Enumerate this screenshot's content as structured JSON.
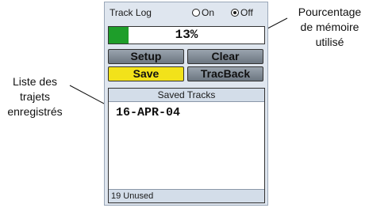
{
  "track_log": {
    "title": "Track Log",
    "on_label": "On",
    "off_label": "Off",
    "selected": "Off",
    "memory_percent_label": "13%",
    "memory_fraction": 0.13
  },
  "buttons": {
    "setup": "Setup",
    "clear": "Clear",
    "save": "Save",
    "tracback": "TracBack"
  },
  "saved_tracks": {
    "header": "Saved Tracks",
    "items": [
      "16-APR-04"
    ],
    "footer": "19 Unused"
  },
  "annotations": {
    "memory": [
      "Pourcentage",
      "de mémoire",
      "utilisé"
    ],
    "list": [
      "Liste des",
      "trajets",
      "enregistrés"
    ]
  },
  "colors": {
    "fill": "#1e9e2a",
    "highlight": "#f2e21a"
  }
}
